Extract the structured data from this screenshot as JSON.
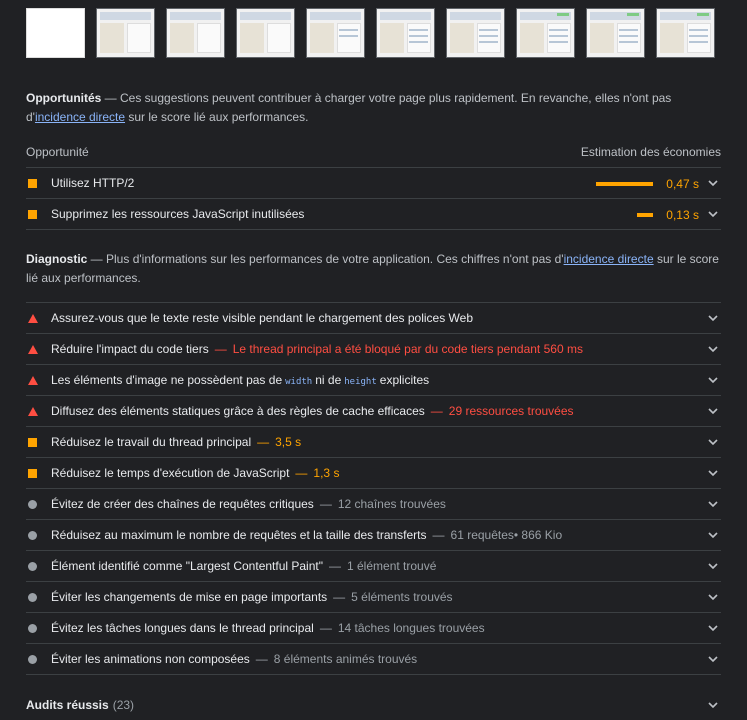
{
  "filmstrip_count": 10,
  "opportunities": {
    "heading": "Opportunités",
    "intro_before": " — Ces suggestions peuvent contribuer à charger votre page plus rapidement. En revanche, elles n'ont pas d'",
    "link": "incidence directe",
    "intro_after": " sur le score lié aux performances.",
    "col_left": "Opportunité",
    "col_right": "Estimation des économies",
    "items": [
      {
        "title": "Utilisez HTTP/2",
        "savings": "0,47 s",
        "fraction": 1.0
      },
      {
        "title": "Supprimez les ressources JavaScript inutilisées",
        "savings": "0,13 s",
        "fraction": 0.28
      }
    ]
  },
  "diagnostics": {
    "heading": "Diagnostic",
    "intro_before": " — Plus d'informations sur les performances de votre application. Ces chiffres n'ont pas d'",
    "link": "incidence directe",
    "intro_after": " sur le score lié aux performances.",
    "items": [
      {
        "icon": "fail-triangle-icon",
        "title": "Assurez-vous que le texte reste visible pendant le chargement des polices Web",
        "detail": ""
      },
      {
        "icon": "fail-triangle-icon",
        "title": "Réduire l'impact du code tiers",
        "detail": "Le thread principal a été bloqué par du code tiers pendant 560 ms"
      },
      {
        "icon": "fail-triangle-icon",
        "title_a": "Les éléments d'image ne possèdent pas de",
        "code_a": "width",
        "title_b": "ni de",
        "code_b": "height",
        "title_c": "explicites"
      },
      {
        "icon": "fail-triangle-icon",
        "title": "Diffusez des éléments statiques grâce à des règles de cache efficaces",
        "detail": "29 ressources trouvées"
      },
      {
        "icon": "warn-square-icon",
        "title": "Réduisez le travail du thread principal",
        "detail": "3,5 s"
      },
      {
        "icon": "warn-square-icon",
        "title": "Réduisez le temps d'exécution de JavaScript",
        "detail": "1,3 s"
      },
      {
        "icon": "info-circle-icon",
        "title": "Évitez de créer des chaînes de requêtes critiques",
        "detail": "12 chaînes trouvées"
      },
      {
        "icon": "info-circle-icon",
        "title": "Réduisez au maximum le nombre de requêtes et la taille des transferts",
        "detail": "61 requêtes• 866 Kio"
      },
      {
        "icon": "info-circle-icon",
        "title": "Élément identifié comme \"Largest Contentful Paint\"",
        "detail": "1 élément trouvé"
      },
      {
        "icon": "info-circle-icon",
        "title": "Éviter les changements de mise en page importants",
        "detail": "5 éléments trouvés"
      },
      {
        "icon": "info-circle-icon",
        "title": "Évitez les tâches longues dans le thread principal",
        "detail": "14 tâches longues trouvées"
      },
      {
        "icon": "info-circle-icon",
        "title": "Éviter les animations non composées",
        "detail": "8 éléments animés trouvés"
      }
    ]
  },
  "passed": {
    "label": "Audits réussis",
    "count": "(23)"
  },
  "colors": {
    "fail": "#ff4e42",
    "warn": "#ffa400",
    "info": "#9aa0a6",
    "link": "#8ab4f8"
  }
}
